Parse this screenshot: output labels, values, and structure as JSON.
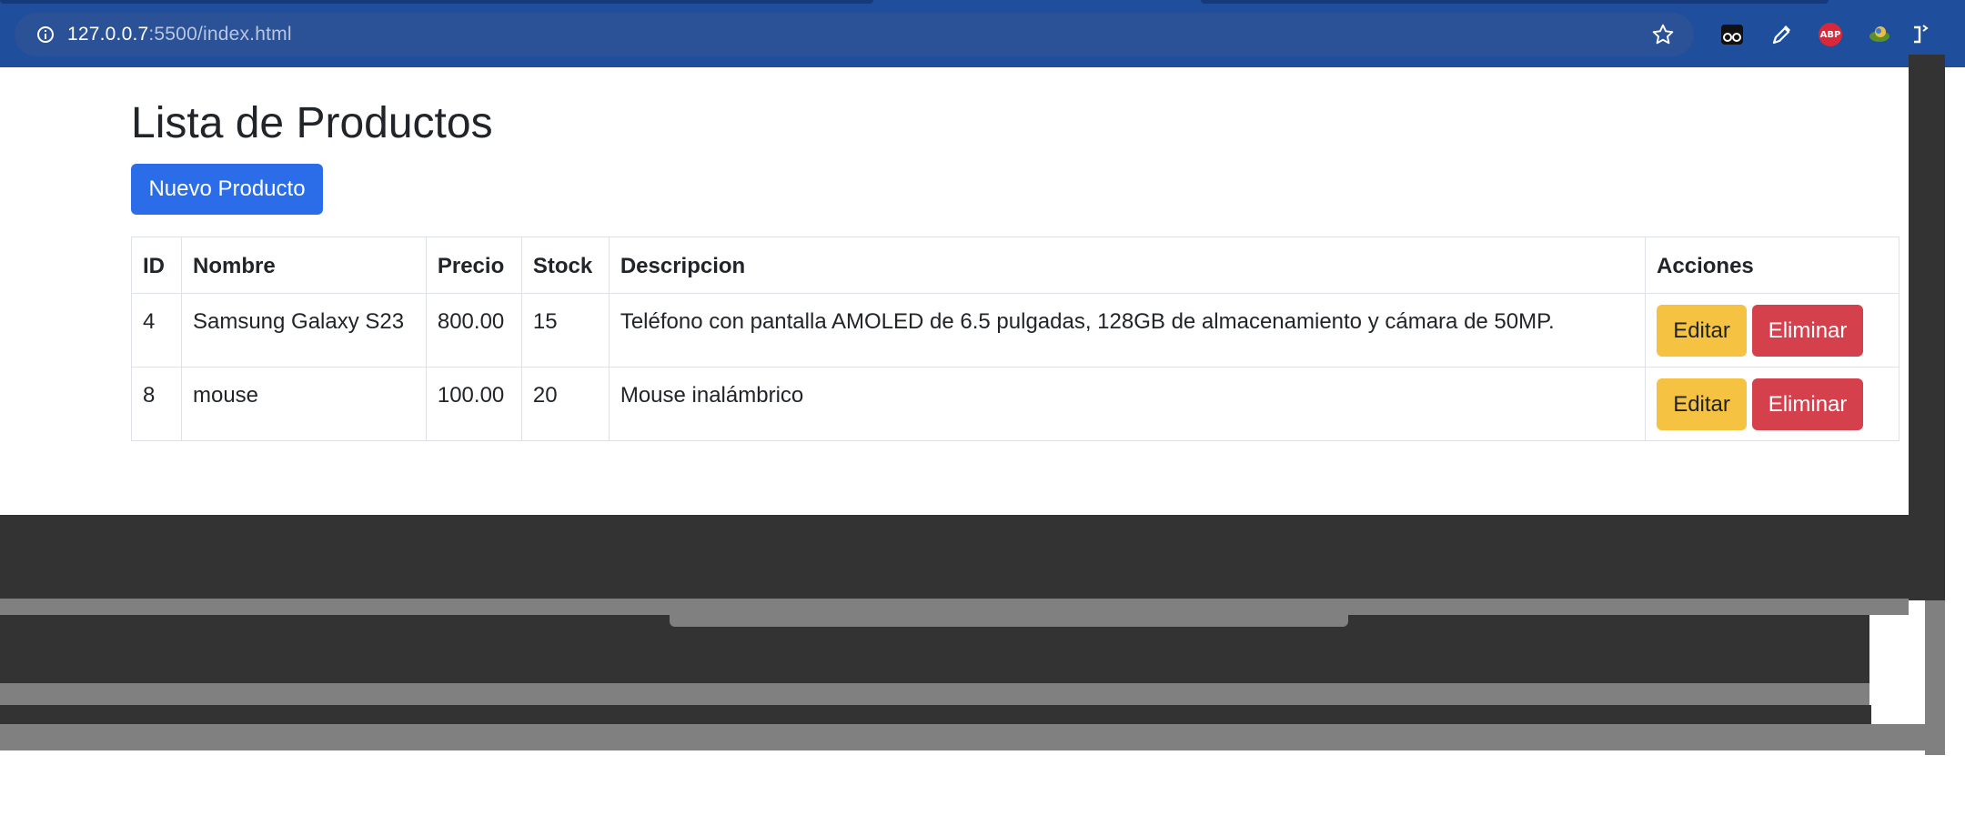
{
  "browser": {
    "url_host": "127.0.0.7",
    "url_path": ":5500/index.html",
    "extensions": [
      "reader-icon",
      "eyedropper-icon",
      "adblock-plus-icon",
      "extension-icon",
      "side-panel-icon"
    ],
    "abp_label": "ABP"
  },
  "page": {
    "title": "Lista de Productos",
    "new_button": "Nuevo Producto"
  },
  "table": {
    "headers": [
      "ID",
      "Nombre",
      "Precio",
      "Stock",
      "Descripcion",
      "Acciones"
    ],
    "rows": [
      {
        "id": "4",
        "nombre": "Samsung Galaxy S23",
        "precio": "800.00",
        "stock": "15",
        "descripcion": "Teléfono con pantalla AMOLED de 6.5 pulgadas, 128GB de almacenamiento y cámara de 50MP.",
        "edit": "Editar",
        "delete": "Eliminar"
      },
      {
        "id": "8",
        "nombre": "mouse",
        "precio": "100.00",
        "stock": "20",
        "descripcion": "Mouse inalámbrico",
        "edit": "Editar",
        "delete": "Eliminar"
      }
    ]
  },
  "colors": {
    "primary": "#2b6de8",
    "warning": "#f5c242",
    "danger": "#d4404c",
    "browser_bar": "#1f4e9c"
  }
}
